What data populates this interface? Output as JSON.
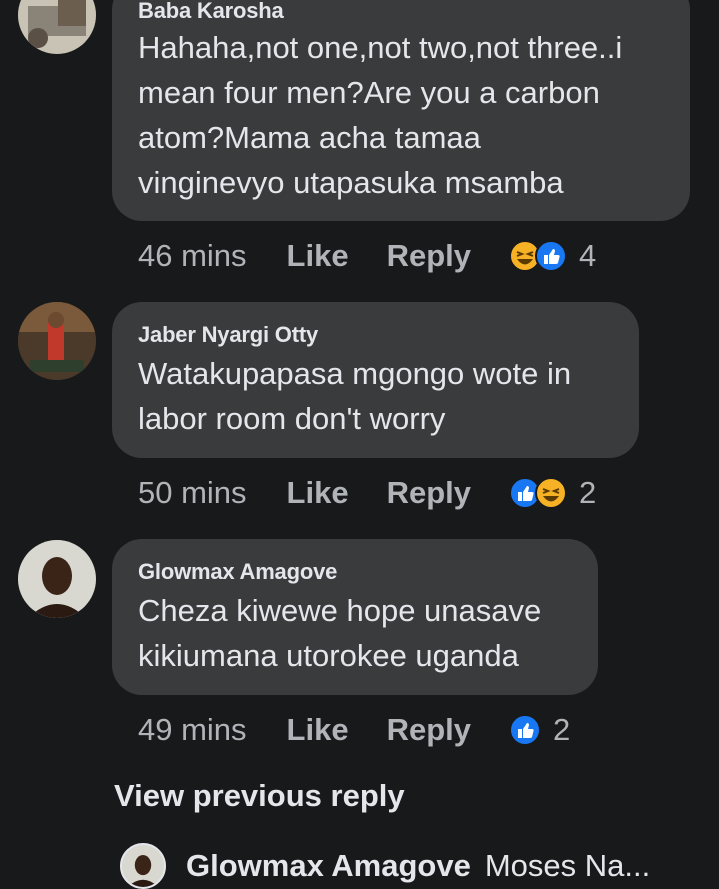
{
  "comments": [
    {
      "author": "Baba Karosha",
      "text": "Hahaha,not one,not two,not three..i\nmean four men?Are you a carbon\natom?Mama acha tamaa\nvinginevyo utapasuka msamba",
      "time": "46 mins",
      "like_label": "Like",
      "reply_label": "Reply",
      "reactions": [
        "haha",
        "like"
      ],
      "reaction_count": "4"
    },
    {
      "author": "Jaber Nyargi Otty",
      "text": "Watakupapasa mgongo wote in\nlabor room don't worry",
      "time": "50 mins",
      "like_label": "Like",
      "reply_label": "Reply",
      "reactions": [
        "like",
        "haha"
      ],
      "reaction_count": "2"
    },
    {
      "author": "Glowmax Amagove",
      "text": "Cheza kiwewe hope unasave\nkikiumana utorokee uganda",
      "time": "49 mins",
      "like_label": "Like",
      "reply_label": "Reply",
      "reactions": [
        "like"
      ],
      "reaction_count": "2"
    }
  ],
  "view_previous_reply": "View previous reply",
  "reply_preview": {
    "author": "Glowmax Amagove",
    "text": "Moses Na..."
  },
  "colors": {
    "background": "#18191a",
    "bubble": "#3a3b3c",
    "like_blue": "#1877f2",
    "haha_yellow": "#f7b125"
  }
}
